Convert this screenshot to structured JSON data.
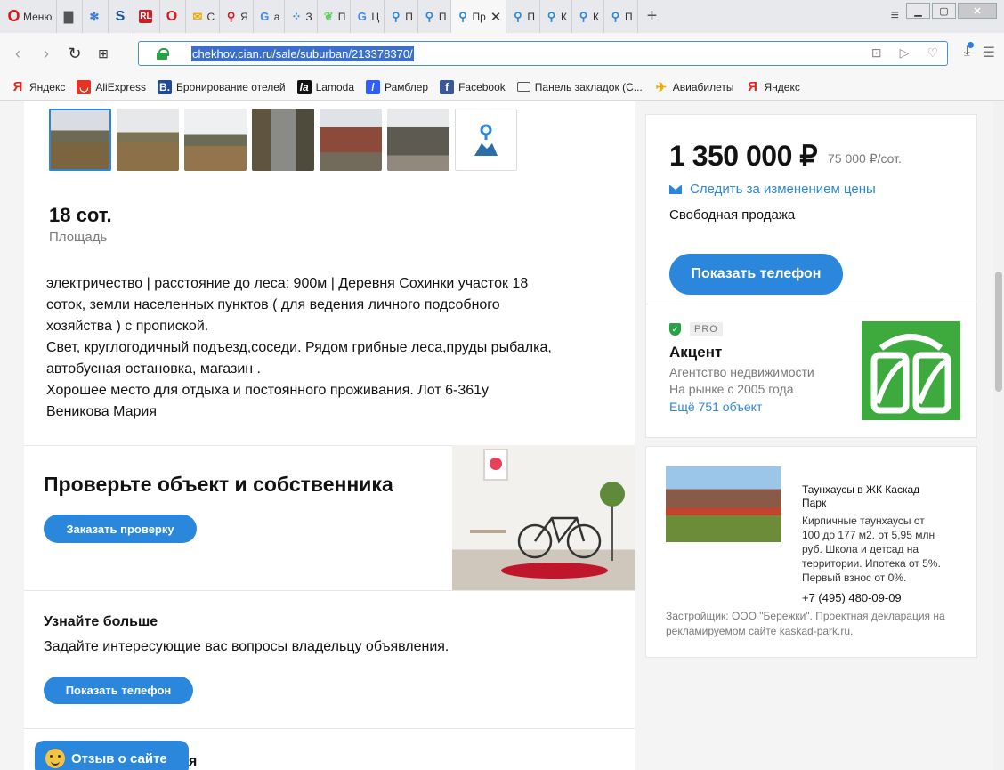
{
  "browser": {
    "menu_label": "Меню",
    "tabs": [
      {
        "icon": "document-icon",
        "label": ""
      },
      {
        "icon": "snowflake-icon",
        "label": ""
      },
      {
        "icon": "s-letter-icon",
        "label": ""
      },
      {
        "icon": "red-square-icon",
        "label": ""
      },
      {
        "icon": "opera-icon",
        "label": ""
      },
      {
        "icon": "mail-icon",
        "label": "С"
      },
      {
        "icon": "pin-icon",
        "label": "Я"
      },
      {
        "icon": "google-icon",
        "label": "а"
      },
      {
        "icon": "dots-icon",
        "label": "З"
      },
      {
        "icon": "leaf-icon",
        "label": "П"
      },
      {
        "icon": "google-icon",
        "label": "Ц"
      },
      {
        "icon": "pin-icon",
        "label": "П"
      },
      {
        "icon": "pin-icon",
        "label": "П"
      },
      {
        "icon": "pin-icon",
        "label": "Пр",
        "active": true
      },
      {
        "icon": "pin-icon",
        "label": "П"
      },
      {
        "icon": "pin-icon",
        "label": "К"
      },
      {
        "icon": "pin-icon",
        "label": "К"
      },
      {
        "icon": "pin-icon",
        "label": "П"
      }
    ],
    "url": "chekhov.cian.ru/sale/suburban/213378370/",
    "bookmarks": [
      {
        "icon": "yandex-icon",
        "label": "Яндекс",
        "color": "#e52620"
      },
      {
        "icon": "aliexpress-icon",
        "label": "AliExpress",
        "color": "#e43225"
      },
      {
        "icon": "booking-icon",
        "label": "Бронирование отелей",
        "color": "#1f4b99"
      },
      {
        "icon": "lamoda-icon",
        "label": "Lamoda",
        "color": "#111111"
      },
      {
        "icon": "rambler-icon",
        "label": "Рамблер",
        "color": "#315efb"
      },
      {
        "icon": "facebook-icon",
        "label": "Facebook",
        "color": "#3b5998"
      },
      {
        "icon": "folder-icon",
        "label": "Панель закладок (С...",
        "color": "#555555"
      },
      {
        "icon": "plane-icon",
        "label": "Авиабилеты",
        "color": "#f2a900"
      },
      {
        "icon": "yandex-icon",
        "label": "Яндекс",
        "color": "#e52620"
      }
    ]
  },
  "listing": {
    "area_value": "18 сот.",
    "area_label": "Площадь",
    "description": "электричество | расстояние до леса: 900м | Деревня Сохинки участок 18\nсоток, земли населенных пунктов ( для ведения личного подсобного\nхозяйства ) с пропиской.\nСвет, круглогодичный подъезд,соседи. Рядом грибные леса,пруды рыбалка,\nавтобусная остановка, магазин .\nХорошее место для отдыха и постоянного проживания. Лот 6-361у\nВеникова Мария",
    "check_title": "Проверьте объект и собственника",
    "check_button": "Заказать проверку",
    "learn_title": "Узнайте больше",
    "learn_text": "Задайте интересующие вас вопросы владельцу объявления.",
    "learn_button": "Показать телефон",
    "cut_text": "я",
    "feedback": "Отзыв о сайте"
  },
  "price_card": {
    "price": "1 350 000 ₽",
    "per_unit": "75 000 ₽/сот.",
    "watch": "Следить за изменением цены",
    "sale_type": "Свободная продажа",
    "phone_button": "Показать телефон"
  },
  "agency": {
    "badge": "PRO",
    "name": "Акцент",
    "type": "Агентство недвижимости",
    "since": "На рынке с 2005 года",
    "more": "Ещё 751 объект"
  },
  "ad": {
    "title": "Таунхаусы в ЖК Каскад Парк",
    "text": "Кирпичные таунхаусы от 100 до 177 м2. от 5,95 млн руб. Школа и детсад на территории. Ипотека от 5%. Первый взнос от 0%.",
    "phone": "+7 (495) 480-09-09",
    "developer": "Застройщик: ООО \"Бережки\". Проектная декларация на рекламируемом сайте kaskad-park.ru."
  },
  "colors": {
    "accent": "#2b87db",
    "agency_logo": "#3caa3c"
  }
}
